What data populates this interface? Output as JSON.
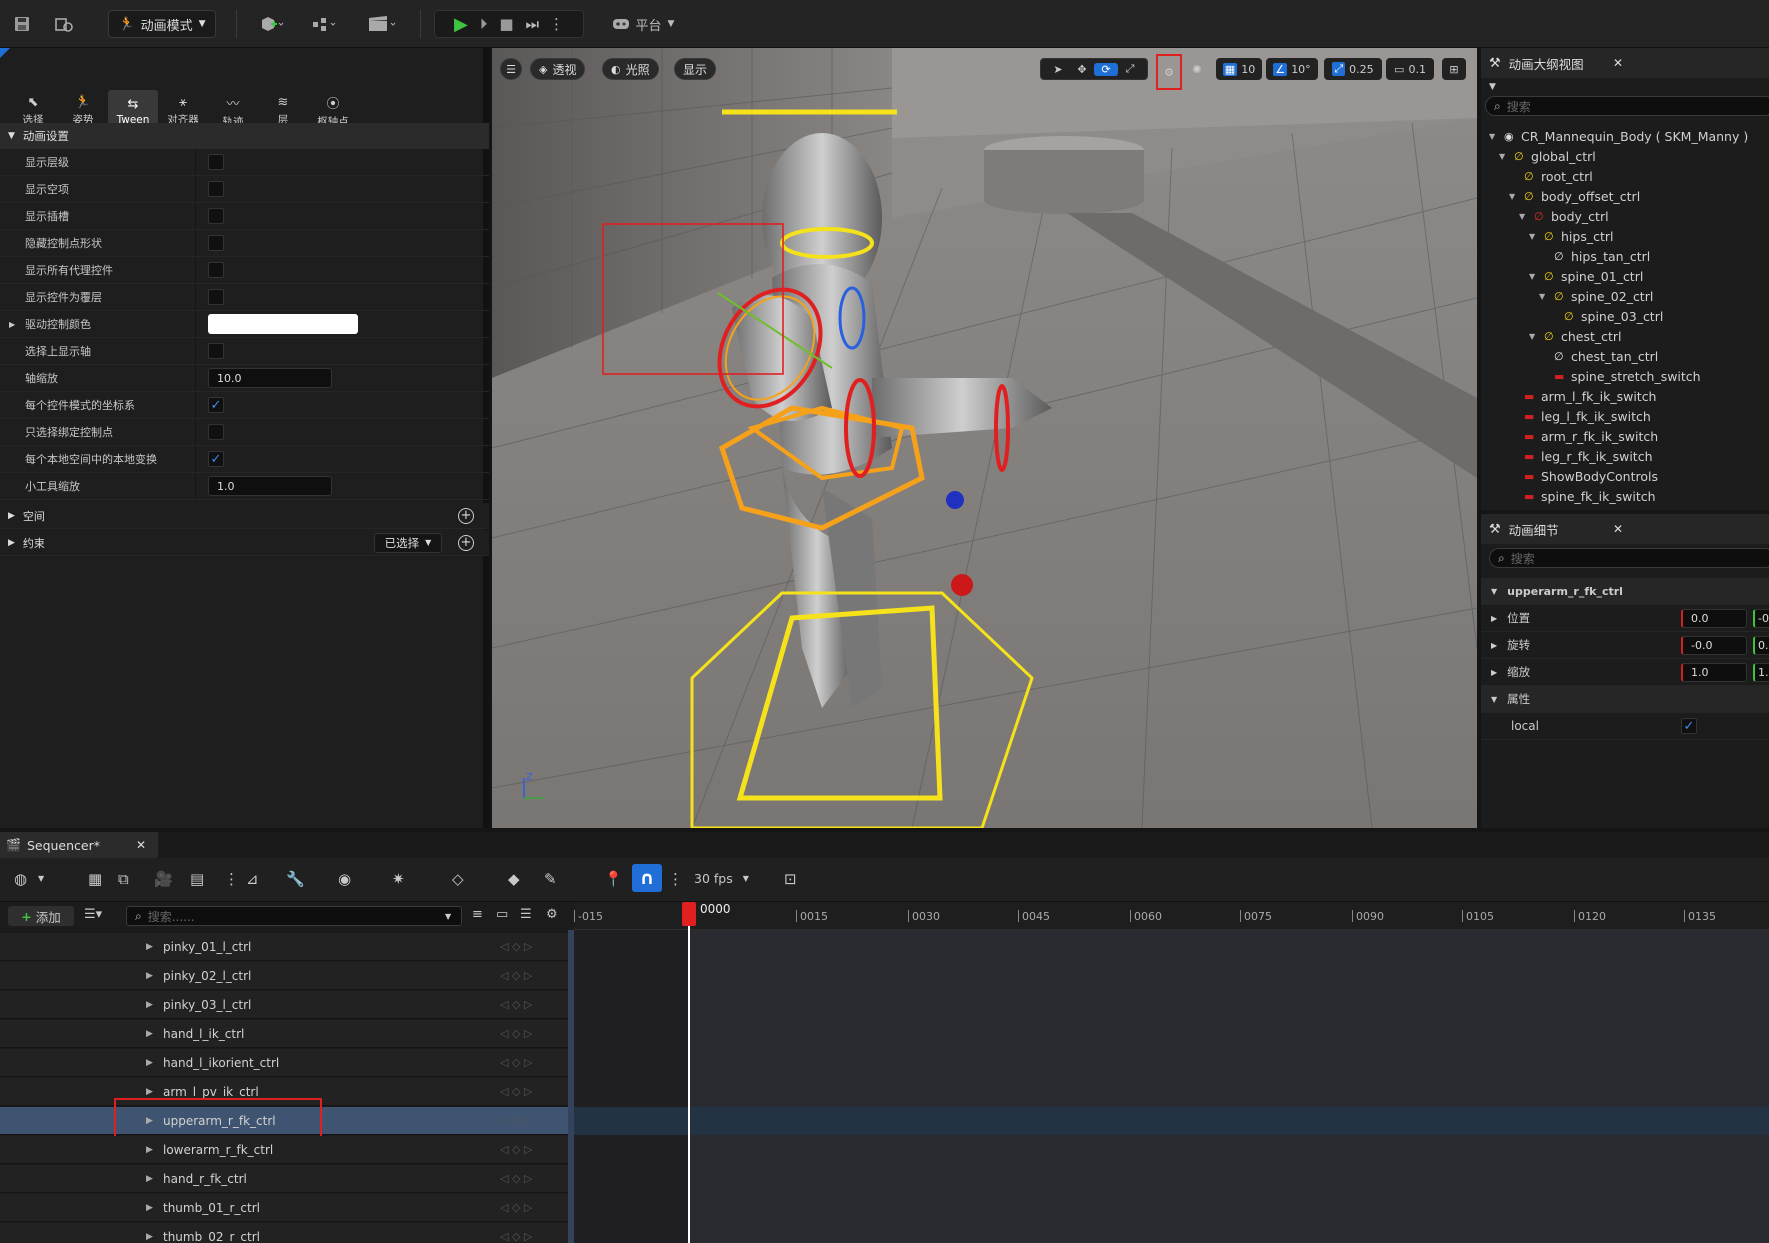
{
  "toolbar": {
    "mode_label": "动画模式",
    "platform_label": "平台"
  },
  "mode_panel": {
    "tabs": [
      "选择",
      "姿势",
      "Tween",
      "对齐器",
      "轨迹",
      "层",
      "枢轴点"
    ],
    "active_tab": "Tween",
    "section_anim_settings": "动画设置",
    "properties": [
      {
        "label": "显示层级",
        "type": "checkbox",
        "value": false
      },
      {
        "label": "显示空项",
        "type": "checkbox",
        "value": false
      },
      {
        "label": "显示插槽",
        "type": "checkbox",
        "value": false
      },
      {
        "label": "隐藏控制点形状",
        "type": "checkbox",
        "value": false
      },
      {
        "label": "显示所有代理控件",
        "type": "checkbox",
        "value": false
      },
      {
        "label": "显示控件为覆层",
        "type": "checkbox",
        "value": false
      },
      {
        "label": "驱动控制颜色",
        "type": "color",
        "value": "#ffffff"
      },
      {
        "label": "选择上显示轴",
        "type": "checkbox",
        "value": false
      },
      {
        "label": "轴缩放",
        "type": "number",
        "value": "10.0"
      },
      {
        "label": "每个控件模式的坐标系",
        "type": "checkbox",
        "value": true
      },
      {
        "label": "只选择绑定控制点",
        "type": "checkbox",
        "value": false
      },
      {
        "label": "每个本地空间中的本地变换",
        "type": "checkbox",
        "value": true
      },
      {
        "label": "小工具缩放",
        "type": "number",
        "value": "1.0"
      }
    ],
    "section_space": "空间",
    "section_constraint": "约束",
    "constraint_dropdown": "已选择"
  },
  "viewport": {
    "perspective_label": "透视",
    "lighting_label": "光照",
    "show_label": "显示",
    "grid_snap": "10",
    "rotation_snap": "10°",
    "scale_snap": "0.25",
    "camera_speed": "0.1",
    "axis_z": "Z"
  },
  "outliner": {
    "title": "动画大纲视图",
    "search_placeholder": "搜索",
    "items": [
      {
        "label": "CR_Mannequin_Body ( SKM_Manny )",
        "depth": 0,
        "icon": "eye"
      },
      {
        "label": "global_ctrl",
        "depth": 1,
        "icon": "ctrl"
      },
      {
        "label": "root_ctrl",
        "depth": 2,
        "icon": "ctrl"
      },
      {
        "label": "body_offset_ctrl",
        "depth": 2,
        "icon": "ctrl"
      },
      {
        "label": "body_ctrl",
        "depth": 3,
        "icon": "ctrl-red"
      },
      {
        "label": "hips_ctrl",
        "depth": 4,
        "icon": "ctrl"
      },
      {
        "label": "hips_tan_ctrl",
        "depth": 5,
        "icon": "ctrl-white"
      },
      {
        "label": "spine_01_ctrl",
        "depth": 4,
        "icon": "ctrl"
      },
      {
        "label": "spine_02_ctrl",
        "depth": 5,
        "icon": "ctrl"
      },
      {
        "label": "spine_03_ctrl",
        "depth": 6,
        "icon": "ctrl"
      },
      {
        "label": "chest_ctrl",
        "depth": 4,
        "icon": "ctrl"
      },
      {
        "label": "chest_tan_ctrl",
        "depth": 5,
        "icon": "ctrl-white"
      },
      {
        "label": "spine_stretch_switch",
        "depth": 5,
        "icon": "switch"
      },
      {
        "label": "arm_l_fk_ik_switch",
        "depth": 2,
        "icon": "switch"
      },
      {
        "label": "leg_l_fk_ik_switch",
        "depth": 2,
        "icon": "switch"
      },
      {
        "label": "arm_r_fk_ik_switch",
        "depth": 2,
        "icon": "switch"
      },
      {
        "label": "leg_r_fk_ik_switch",
        "depth": 2,
        "icon": "switch"
      },
      {
        "label": "ShowBodyControls",
        "depth": 2,
        "icon": "switch"
      },
      {
        "label": "spine_fk_ik_switch",
        "depth": 2,
        "icon": "switch"
      }
    ]
  },
  "details": {
    "title": "动画细节",
    "search_placeholder": "搜索",
    "control_name": "upperarm_r_fk_ctrl",
    "rows": [
      {
        "label": "位置",
        "x": "0.0",
        "y": "-0"
      },
      {
        "label": "旋转",
        "x": "-0.0",
        "y": "0."
      },
      {
        "label": "缩放",
        "x": "1.0",
        "y": "1."
      }
    ],
    "attributes_label": "属性",
    "local_label": "local",
    "local_value": true
  },
  "sequencer": {
    "tab_label": "Sequencer*",
    "add_label": "添加",
    "search_placeholder": "搜索......",
    "fps_label": "30 fps",
    "current_frame": "0000",
    "ruler_labels": [
      "-015",
      "0015",
      "0030",
      "0045",
      "0060",
      "0075",
      "0090",
      "0105",
      "0120",
      "0135"
    ],
    "tracks": [
      "pinky_01_l_ctrl",
      "pinky_02_l_ctrl",
      "pinky_03_l_ctrl",
      "hand_l_ik_ctrl",
      "hand_l_ikorient_ctrl",
      "arm_l_pv_ik_ctrl",
      "upperarm_r_fk_ctrl",
      "lowerarm_r_fk_ctrl",
      "hand_r_fk_ctrl",
      "thumb_01_r_ctrl",
      "thumb_02_r_ctrl"
    ],
    "selected_track": "upperarm_r_fk_ctrl"
  },
  "colors": {
    "accent_blue": "#1f6fd6",
    "highlight_red": "#e02020",
    "gizmo_yellow": "#f5e21a"
  }
}
